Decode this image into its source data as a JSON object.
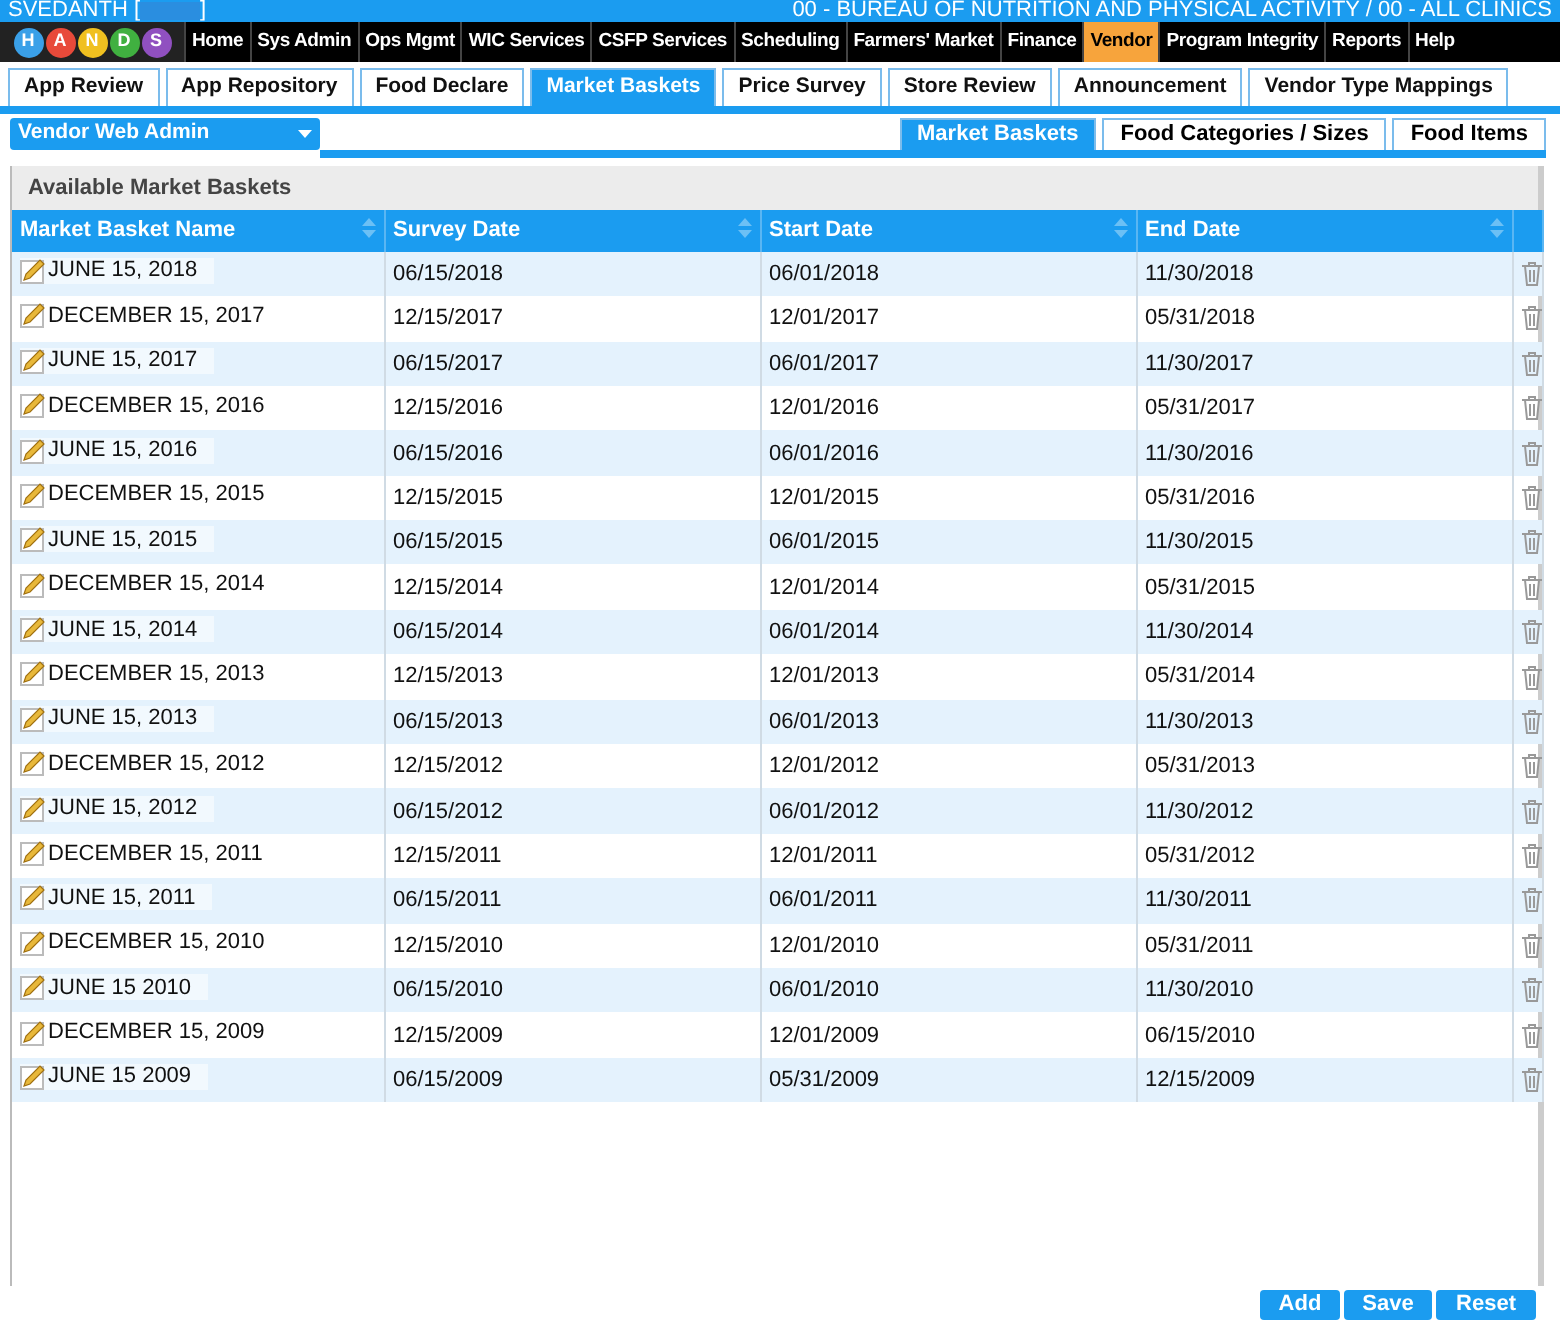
{
  "header": {
    "user": "SVEDANTH [",
    "user_end": "]",
    "agency": "00 - BUREAU OF NUTRITION AND PHYSICAL ACTIVITY / 00 - ALL CLINICS",
    "logo_letters": [
      "H",
      "A",
      "N",
      "D",
      "S"
    ]
  },
  "main_menu": [
    {
      "label": "Home",
      "selected": false
    },
    {
      "label": "Sys Admin",
      "selected": false
    },
    {
      "label": "Ops Mgmt",
      "selected": false
    },
    {
      "label": "WIC Services",
      "selected": false
    },
    {
      "label": "CSFP Services",
      "selected": false
    },
    {
      "label": "Scheduling",
      "selected": false
    },
    {
      "label": "Farmers' Market",
      "selected": false
    },
    {
      "label": "Finance",
      "selected": false
    },
    {
      "label": "Vendor",
      "selected": true
    },
    {
      "label": "Program Integrity",
      "selected": false
    },
    {
      "label": "Reports",
      "selected": false
    },
    {
      "label": "Help",
      "selected": false
    }
  ],
  "tabs": [
    {
      "label": "App Review",
      "selected": false
    },
    {
      "label": "App Repository",
      "selected": false
    },
    {
      "label": "Food Declare",
      "selected": false
    },
    {
      "label": "Market Baskets",
      "selected": true
    },
    {
      "label": "Price Survey",
      "selected": false
    },
    {
      "label": "Store Review",
      "selected": false
    },
    {
      "label": "Announcement",
      "selected": false
    },
    {
      "label": "Vendor Type Mappings",
      "selected": false
    }
  ],
  "role_dropdown": {
    "value": "Vendor Web Admin"
  },
  "sub_tabs": [
    {
      "label": "Market Baskets",
      "selected": true
    },
    {
      "label": "Food Categories / Sizes",
      "selected": false
    },
    {
      "label": "Food Items",
      "selected": false
    }
  ],
  "panel": {
    "title": "Available Market Baskets",
    "table": {
      "columns": [
        "Market Basket Name",
        "Survey Date",
        "Start Date",
        "End Date"
      ],
      "rows": [
        [
          "JUNE 15, 2018",
          "06/15/2018",
          "06/01/2018",
          "11/30/2018"
        ],
        [
          "DECEMBER 15, 2017",
          "12/15/2017",
          "12/01/2017",
          "05/31/2018"
        ],
        [
          "JUNE 15, 2017",
          "06/15/2017",
          "06/01/2017",
          "11/30/2017"
        ],
        [
          "DECEMBER 15, 2016",
          "12/15/2016",
          "12/01/2016",
          "05/31/2017"
        ],
        [
          "JUNE 15, 2016",
          "06/15/2016",
          "06/01/2016",
          "11/30/2016"
        ],
        [
          "DECEMBER 15, 2015",
          "12/15/2015",
          "12/01/2015",
          "05/31/2016"
        ],
        [
          "JUNE 15, 2015",
          "06/15/2015",
          "06/01/2015",
          "11/30/2015"
        ],
        [
          "DECEMBER 15, 2014",
          "12/15/2014",
          "12/01/2014",
          "05/31/2015"
        ],
        [
          "JUNE 15, 2014",
          "06/15/2014",
          "06/01/2014",
          "11/30/2014"
        ],
        [
          "DECEMBER 15, 2013",
          "12/15/2013",
          "12/01/2013",
          "05/31/2014"
        ],
        [
          "JUNE 15, 2013",
          "06/15/2013",
          "06/01/2013",
          "11/30/2013"
        ],
        [
          "DECEMBER 15, 2012",
          "12/15/2012",
          "12/01/2012",
          "05/31/2013"
        ],
        [
          "JUNE 15, 2012",
          "06/15/2012",
          "06/01/2012",
          "11/30/2012"
        ],
        [
          "DECEMBER 15, 2011",
          "12/15/2011",
          "12/01/2011",
          "05/31/2012"
        ],
        [
          "JUNE 15, 2011",
          "06/15/2011",
          "06/01/2011",
          "11/30/2011"
        ],
        [
          "DECEMBER 15, 2010",
          "12/15/2010",
          "12/01/2010",
          "05/31/2011"
        ],
        [
          "JUNE 15 2010",
          "06/15/2010",
          "06/01/2010",
          "11/30/2010"
        ],
        [
          "DECEMBER 15, 2009",
          "12/15/2009",
          "12/01/2009",
          "06/15/2010"
        ],
        [
          "JUNE 15 2009",
          "06/15/2009",
          "05/31/2009",
          "12/15/2009"
        ]
      ]
    }
  },
  "buttons": [
    "Add",
    "Save",
    "Reset"
  ]
}
